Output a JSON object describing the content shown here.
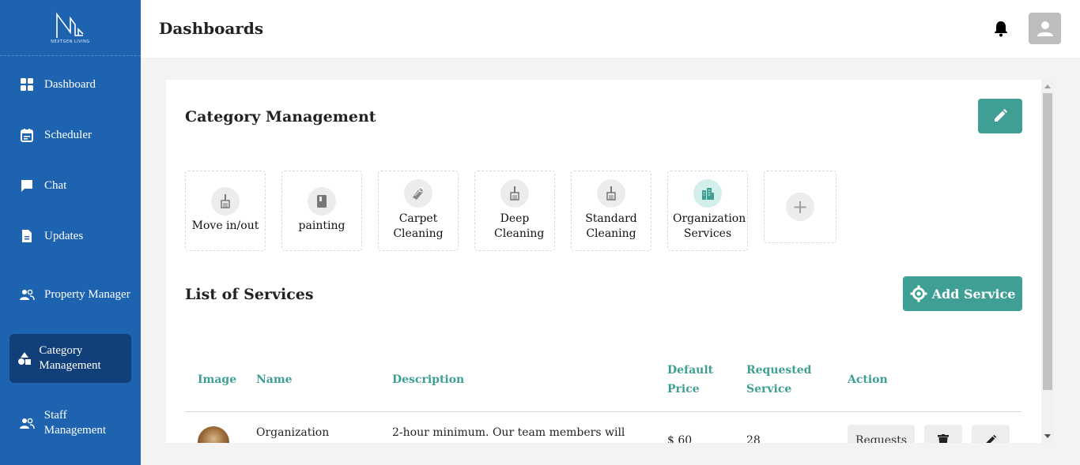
{
  "brand": {
    "logo_text": "NEXTGEN LIVING"
  },
  "header": {
    "title": "Dashboards"
  },
  "sidebar": {
    "items": [
      {
        "label": "Dashboard",
        "icon": "dashboard-icon"
      },
      {
        "label": "Scheduler",
        "icon": "calendar-icon"
      },
      {
        "label": "Chat",
        "icon": "chat-icon"
      },
      {
        "label": "Updates",
        "icon": "document-icon"
      },
      {
        "label": "Property Manager",
        "icon": "people-icon"
      },
      {
        "label": "Category Management",
        "icon": "shapes-icon",
        "active": true
      },
      {
        "label": "Staff Management",
        "icon": "people-icon"
      }
    ]
  },
  "category_section": {
    "title": "Category Management",
    "categories": [
      {
        "label": "Move in/out",
        "icon": "broom-icon"
      },
      {
        "label": "painting",
        "icon": "paint-icon"
      },
      {
        "label": "Carpet Cleaning",
        "icon": "carpet-icon"
      },
      {
        "label": "Deep Cleaning",
        "icon": "broom-icon"
      },
      {
        "label": "Standard Cleaning",
        "icon": "broom-icon"
      },
      {
        "label": "Organization Services",
        "icon": "buildings-icon"
      }
    ],
    "add_label": "+"
  },
  "services_section": {
    "title": "List of Services",
    "add_button": "Add Service",
    "columns": [
      "Image",
      "Name",
      "Description",
      "Default Price",
      "Requested Service",
      "Action"
    ],
    "rows": [
      {
        "name": "Organization",
        "description": "2-hour minimum. Our team members will",
        "price": "$ 60",
        "requested": "28",
        "requests_label": "Requests"
      }
    ]
  },
  "colors": {
    "sidebar": "#1d63b0",
    "sidebar_active": "#103f7a",
    "accent": "#3f9f94"
  }
}
